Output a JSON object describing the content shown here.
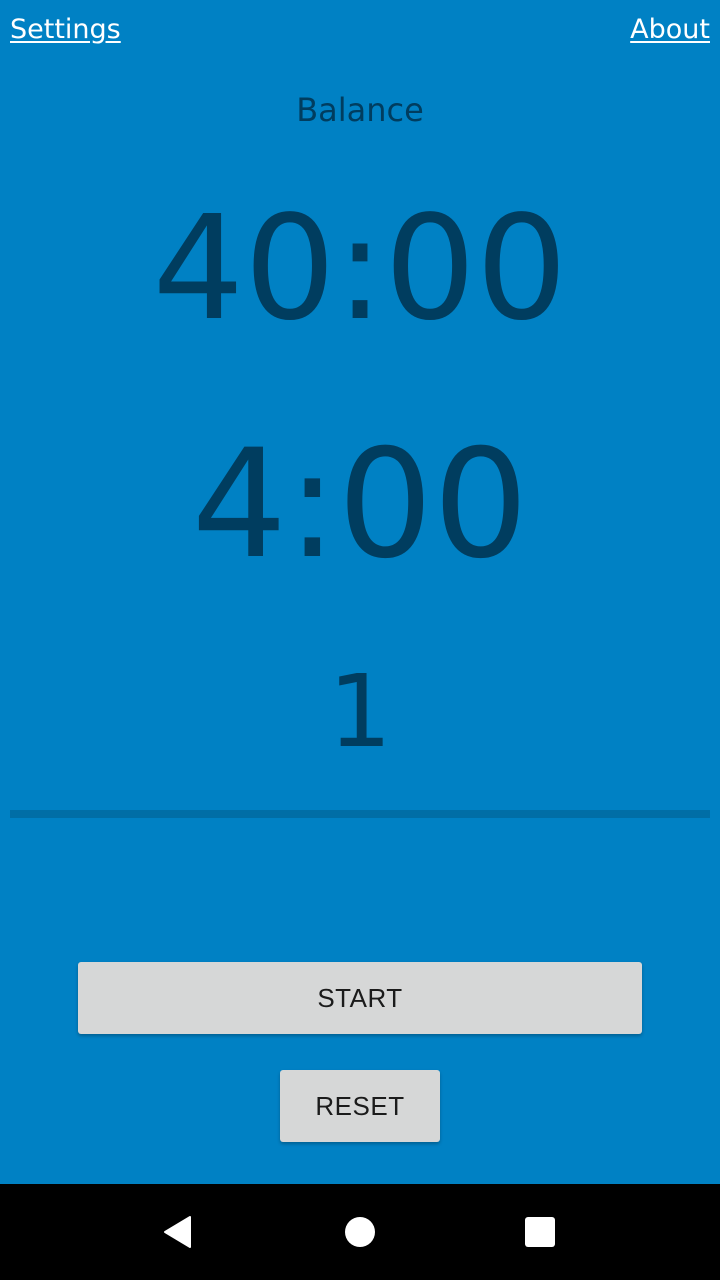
{
  "header": {
    "settings_label": "Settings",
    "about_label": "About"
  },
  "timer": {
    "mode": "Balance",
    "total_time": "40:00",
    "period_time": "4:00",
    "round": "1"
  },
  "controls": {
    "start_label": "START",
    "reset_label": "RESET"
  },
  "navbar": {
    "back_icon": "back-triangle-icon",
    "home_icon": "home-circle-icon",
    "recents_icon": "recents-square-icon"
  },
  "colors": {
    "background": "#0081C4",
    "text_dark": "#003d5f",
    "button": "#d6d7d7",
    "navbar": "#000000"
  }
}
